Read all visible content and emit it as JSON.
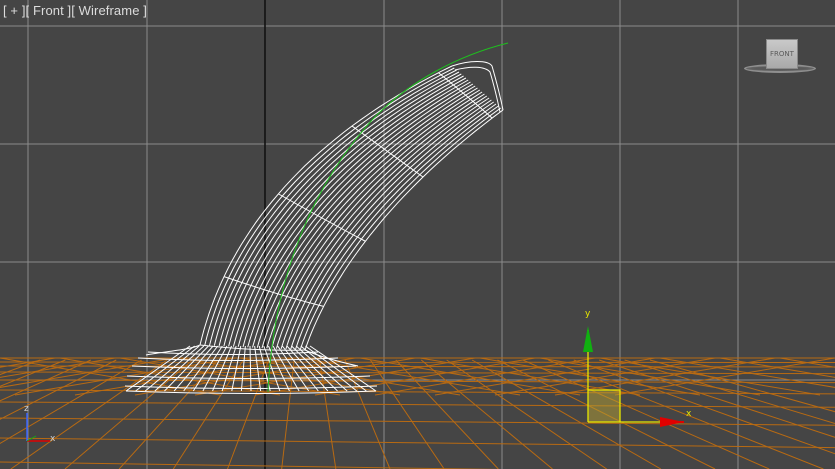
{
  "viewport": {
    "label": {
      "plus": "[ + ]",
      "view": "[ Front ]",
      "shading": "[ Wireframe ]"
    },
    "viewcube_face": "FRONT",
    "gizmo": {
      "x_label": "x",
      "y_label": "y"
    },
    "world_axis": {
      "x_label": "x",
      "z_label": "z"
    }
  },
  "colors": {
    "background": "#454545",
    "grid": "#8c8c8c",
    "wire_selected": "#ffffff",
    "wire_ground": "#b86a12",
    "gizmo_x": "#e00000",
    "gizmo_y": "#10b010",
    "gizmo_plane": "#e8e800",
    "spline": "#1fbf1f"
  }
}
